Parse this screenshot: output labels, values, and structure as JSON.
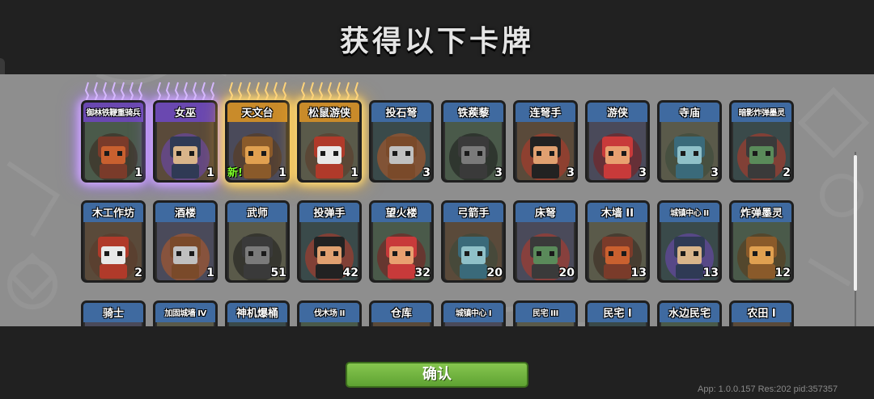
{
  "header": {
    "title": "获得以下卡牌"
  },
  "cards_row1": [
    {
      "name": "御林铁鞭重骑兵",
      "count": "1",
      "rarity": "purple",
      "icon": "heavy-cavalry-icon"
    },
    {
      "name": "女巫",
      "count": "1",
      "rarity": "purple",
      "icon": "witch-icon"
    },
    {
      "name": "天文台",
      "count": "1",
      "rarity": "gold",
      "new": "新!",
      "icon": "observatory-icon"
    },
    {
      "name": "松鼠游侠",
      "count": "1",
      "rarity": "gold",
      "icon": "squirrel-ranger-icon"
    },
    {
      "name": "投石弩",
      "count": "3",
      "rarity": "blue",
      "icon": "stone-ballista-icon"
    },
    {
      "name": "铁蒺藜",
      "count": "3",
      "rarity": "blue",
      "icon": "caltrops-icon"
    },
    {
      "name": "连弩手",
      "count": "3",
      "rarity": "blue",
      "icon": "repeating-crossbowman-icon"
    },
    {
      "name": "游侠",
      "count": "3",
      "rarity": "blue",
      "icon": "ranger-icon"
    },
    {
      "name": "寺庙",
      "count": "3",
      "rarity": "blue",
      "icon": "temple-icon"
    },
    {
      "name": "暗影炸弹墨灵",
      "count": "2",
      "rarity": "blue",
      "icon": "shadow-bomb-spirit-icon"
    }
  ],
  "cards_row2": [
    {
      "name": "木工作坊",
      "count": "2",
      "rarity": "blue",
      "icon": "carpentry-workshop-icon"
    },
    {
      "name": "酒楼",
      "count": "1",
      "rarity": "blue",
      "icon": "tavern-icon"
    },
    {
      "name": "武师",
      "count": "51",
      "rarity": "blue",
      "icon": "martial-artist-icon"
    },
    {
      "name": "投弹手",
      "count": "42",
      "rarity": "blue",
      "icon": "bomber-icon"
    },
    {
      "name": "望火楼",
      "count": "32",
      "rarity": "blue",
      "icon": "watchtower-icon"
    },
    {
      "name": "弓箭手",
      "count": "20",
      "rarity": "blue",
      "icon": "archer-icon"
    },
    {
      "name": "床弩",
      "count": "20",
      "rarity": "blue",
      "icon": "bed-crossbow-icon"
    },
    {
      "name": "木墙 II",
      "count": "13",
      "rarity": "blue",
      "icon": "wooden-wall-icon"
    },
    {
      "name": "城镇中心 II",
      "count": "13",
      "rarity": "blue",
      "icon": "town-center-icon"
    },
    {
      "name": "炸弹墨灵",
      "count": "12",
      "rarity": "blue",
      "icon": "bomb-spirit-icon"
    }
  ],
  "cards_row3": [
    {
      "name": "骑士",
      "rarity": "blue",
      "icon": "knight-icon"
    },
    {
      "name": "加固城墙 IV",
      "rarity": "blue",
      "icon": "reinforced-wall-icon"
    },
    {
      "name": "神机爆桶",
      "rarity": "blue",
      "icon": "explosive-barrel-icon"
    },
    {
      "name": "伐木场 II",
      "rarity": "blue",
      "icon": "lumber-mill-icon"
    },
    {
      "name": "仓库",
      "rarity": "blue",
      "icon": "warehouse-icon"
    },
    {
      "name": "城镇中心 I",
      "rarity": "blue",
      "icon": "town-center-icon"
    },
    {
      "name": "民宅 III",
      "rarity": "blue",
      "icon": "house-icon"
    },
    {
      "name": "民宅 I",
      "rarity": "blue",
      "icon": "house-icon"
    },
    {
      "name": "水边民宅",
      "rarity": "blue",
      "icon": "waterside-house-icon"
    },
    {
      "name": "农田 I",
      "rarity": "blue",
      "icon": "farmland-icon"
    }
  ],
  "footer": {
    "confirm_label": "确认",
    "version": "App: 1.0.0.157 Res:202 pid:357357"
  },
  "colors": {
    "purple": "#6a48b0",
    "gold": "#c98b2a",
    "blue": "#3f6aa0",
    "confirm": "#6fb23e"
  }
}
